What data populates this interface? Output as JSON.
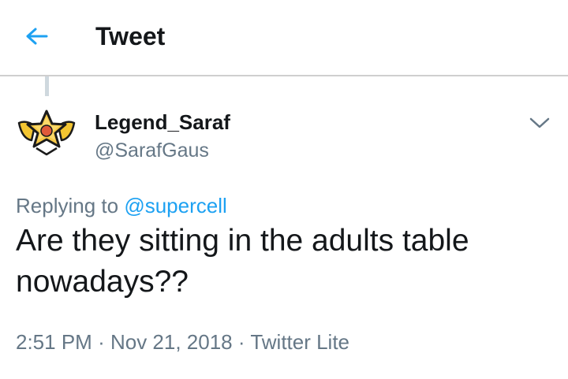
{
  "header": {
    "title": "Tweet",
    "back_icon": "arrow-left-icon"
  },
  "tweet": {
    "display_name": "Legend_Saraf",
    "handle": "@SarafGaus",
    "replying_prefix": "Replying to",
    "replying_to": "@supercell",
    "text": "Are they sitting in the adults table nowadays??",
    "time": "2:51 PM",
    "date": "Nov 21, 2018",
    "source": "Twitter Lite",
    "separator": "·"
  },
  "colors": {
    "accent": "#1da1f2",
    "secondary_text": "#657786",
    "primary_text": "#14171a",
    "avatar_gold": "#f3c531",
    "avatar_red": "#e05a3a"
  }
}
